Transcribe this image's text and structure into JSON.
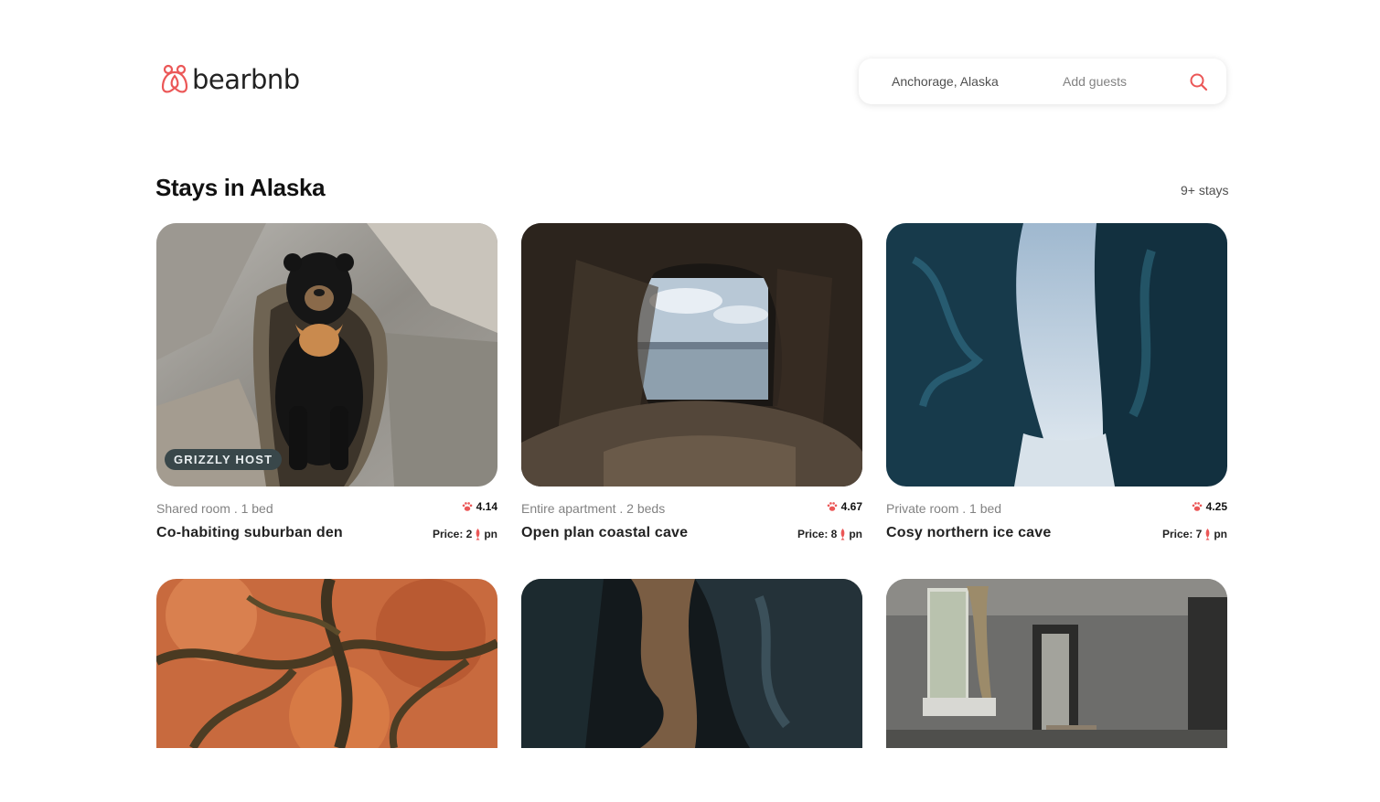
{
  "header": {
    "brand": "bearbnb",
    "search": {
      "location": "Anchorage, Alaska",
      "guests": "Add guests"
    }
  },
  "section": {
    "title": "Stays in Alaska",
    "count": "9+ stays"
  },
  "colors": {
    "accent": "#eb5757",
    "badge_bg": "#39474a"
  },
  "listings": [
    {
      "badge": "GRIZZLY HOST",
      "meta": "Shared room . 1 bed",
      "rating": "4.14",
      "name": "Co-habiting suburban den",
      "price_label": "Price: 2",
      "price_suffix": "pn",
      "image": "sun-bear-in-rock-den"
    },
    {
      "meta": "Entire apartment . 2 beds",
      "rating": "4.67",
      "name": "Open plan coastal cave",
      "price_label": "Price: 8",
      "price_suffix": "pn",
      "image": "coastal-cave-ocean-view"
    },
    {
      "meta": "Private room . 1 bed",
      "rating": "4.25",
      "name": "Cosy northern ice cave",
      "price_label": "Price: 7",
      "price_suffix": "pn",
      "image": "blue-ice-cave"
    },
    {
      "image": "autumn-maple-tree"
    },
    {
      "image": "dark-cave-rock-formation"
    },
    {
      "image": "abandoned-room-interior"
    }
  ],
  "icons": {
    "logo": "bear-logo-icon",
    "search": "search-icon",
    "rating": "paw-icon",
    "price": "fish-icon"
  }
}
